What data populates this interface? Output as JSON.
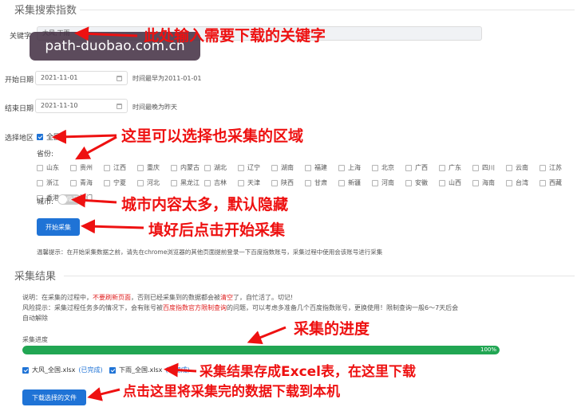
{
  "collect_section": {
    "title": "采集搜索指数",
    "keyword_label": "关键字",
    "keyword_value": "大风,下雨",
    "start_label": "开始日期",
    "start_value": "2021-11-01",
    "start_hint": "时间最早为2011-01-01",
    "end_label": "结束日期",
    "end_value": "2021-11-10",
    "end_hint": "时间最晚为昨天",
    "region_label": "选择地区",
    "national_label": "全国",
    "province_label": "省份:",
    "provinces": [
      "山东",
      "贵州",
      "江西",
      "重庆",
      "内蒙古",
      "湖北",
      "辽宁",
      "湖南",
      "福建",
      "上海",
      "北京",
      "广西",
      "广东",
      "四川",
      "云南",
      "江苏",
      "浙江",
      "青海",
      "宁夏",
      "河北",
      "黑龙江",
      "吉林",
      "天津",
      "陕西",
      "甘肃",
      "新疆",
      "河南",
      "安徽",
      "山西",
      "海南",
      "台湾",
      "西藏",
      "香港",
      "澳门"
    ],
    "city_label": "城市:",
    "city_toggle_text": "隐藏",
    "start_button": "开始采集",
    "tip": "温馨提示：在开始采集数据之前，请先在chrome浏览器的其他页面提前登录一下百度指数账号，采集过程中使用会该账号进行采集"
  },
  "watermark": "path-duobao.com.cn",
  "annotations": {
    "keyword": "此处输入需要下载的关键字",
    "region": "这里可以选择也采集的区域",
    "city": "城市内容太多，默认隐藏",
    "start": "填好后点击开始采集",
    "progress": "采集的进度",
    "excel": "采集结果存成Excel表，在这里下载",
    "download": "点击这里将采集完的数据下载到本机"
  },
  "result_section": {
    "title": "采集结果",
    "note1_a": "说明：在采集的过程中，",
    "note1_b": "不要刷新页面",
    "note1_c": "，否则已经采集到的数据都会被",
    "note1_d": "清空",
    "note1_e": "了，自忙活了。切记!",
    "note2_a": "风险提示：采集过程任务多的情况下，会有账号被",
    "note2_b": "百度指数官方限制查询",
    "note2_c": "的问题，可以考虑多准备几个百度指数账号，更换使用！限制查询一般6～7天后会",
    "note2_d": "自动解除",
    "progress_label": "采集进度",
    "progress_text": "100%",
    "progress_value": 1.0,
    "files": [
      {
        "name": "大风_全国.xlsx",
        "status": "(已完成)"
      },
      {
        "name": "下雨_全国.xlsx",
        "status": "(已完成)"
      }
    ],
    "download_button": "下载选择的文件"
  },
  "colors": {
    "accent": "#1f73d6",
    "annotation": "#ee1111",
    "progress": "#21a653"
  }
}
